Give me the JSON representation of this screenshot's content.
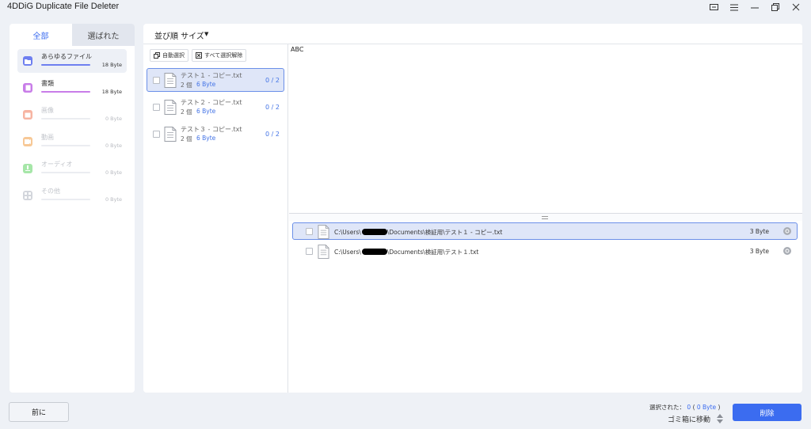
{
  "app": {
    "title": "4DDiG Duplicate File Deleter"
  },
  "window_controls": [
    "feedback-icon",
    "menu-icon",
    "minimize-icon",
    "restore-icon",
    "close-icon"
  ],
  "tabs": [
    {
      "label": "全部",
      "active": true
    },
    {
      "label": "選ばれた",
      "active": false
    }
  ],
  "categories": [
    {
      "label": "あらゆるファイル",
      "size": "18 Byte",
      "selected": true,
      "color": "#6e7ff0",
      "fill": 1.0,
      "icon": "folder-icon"
    },
    {
      "label": "書類",
      "size": "18 Byte",
      "selected": false,
      "color": "#c87de8",
      "fill": 1.0,
      "icon": "document-icon"
    },
    {
      "label": "画像",
      "size": "0 Byte",
      "selected": false,
      "color": "#f7b4a2",
      "fill": 0,
      "icon": "image-icon"
    },
    {
      "label": "動画",
      "size": "0 Byte",
      "selected": false,
      "color": "#f7c896",
      "fill": 0,
      "icon": "video-icon"
    },
    {
      "label": "オーディオ",
      "size": "0 Byte",
      "selected": false,
      "color": "#a6e6a8",
      "fill": 0,
      "icon": "audio-icon"
    },
    {
      "label": "その他",
      "size": "0 Byte",
      "selected": false,
      "color": "#d3d6dc",
      "fill": 0,
      "icon": "other-icon"
    }
  ],
  "sort": {
    "label": "並び順 サイズ"
  },
  "toolbar": {
    "auto_select": "自動選択",
    "deselect_all": "すべて選択解除"
  },
  "groups": [
    {
      "name": "テスト１ - コピー.txt",
      "count": "2 個",
      "size": "6 Byte",
      "ratio": "0 / 2",
      "selected": true
    },
    {
      "name": "テスト２ - コピー.txt",
      "count": "2 個",
      "size": "6 Byte",
      "ratio": "0 / 2",
      "selected": false
    },
    {
      "name": "テスト３ - コピー.txt",
      "count": "2 個",
      "size": "6 Byte",
      "ratio": "0 / 2",
      "selected": false
    }
  ],
  "preview": {
    "text": "ABC"
  },
  "files": [
    {
      "path_prefix": "C:\\Users\\",
      "path_suffix": "\\Documents\\検証用\\テスト１ - コピー.txt",
      "size": "3 Byte",
      "selected": true
    },
    {
      "path_prefix": "C:\\Users\\",
      "path_suffix": "\\Documents\\検証用\\テスト１.txt",
      "size": "3 Byte",
      "selected": false
    }
  ],
  "footer": {
    "prev_label": "前に",
    "selected_label": "選択された：",
    "selected_count": "0",
    "selected_size": "0 Byte",
    "move_label": "ゴミ箱に移動",
    "delete_label": "削除"
  },
  "colors": {
    "accent": "#3b6cf0",
    "selection_bg": "#dfe6f8",
    "selection_border": "#6b8fe8"
  }
}
